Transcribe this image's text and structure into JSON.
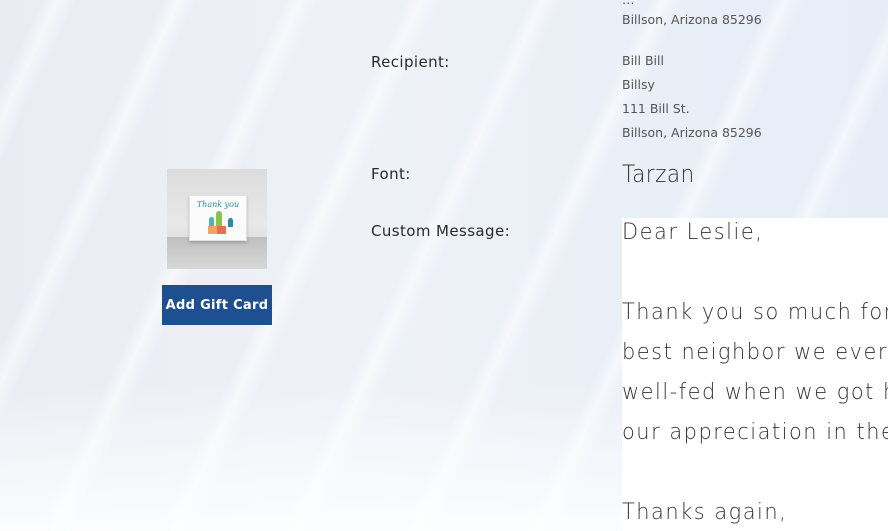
{
  "sender": {
    "address_cutoff": "Billson, Arizona 85296"
  },
  "recipient": {
    "label": "Recipient:",
    "lines": [
      "Bill Bill",
      "Billsy",
      "111 Bill St.",
      "Billson, Arizona 85296"
    ]
  },
  "font": {
    "label": "Font:",
    "value": "Tarzan"
  },
  "custom_message": {
    "label": "Custom Message:",
    "lines": [
      "Dear Leslie,",
      "",
      "Thank you so much for watch",
      "best neighbor we ever could h",
      "well-fed when we got home, so",
      "our appreciation in the card. C",
      "",
      "Thanks again,"
    ]
  },
  "gift_card": {
    "card_text": "Thank you",
    "button_label": "Add Gift Card"
  },
  "colors": {
    "button_bg": "#1d4f91",
    "button_text": "#ffffff",
    "message_bg": "#ffffff"
  }
}
